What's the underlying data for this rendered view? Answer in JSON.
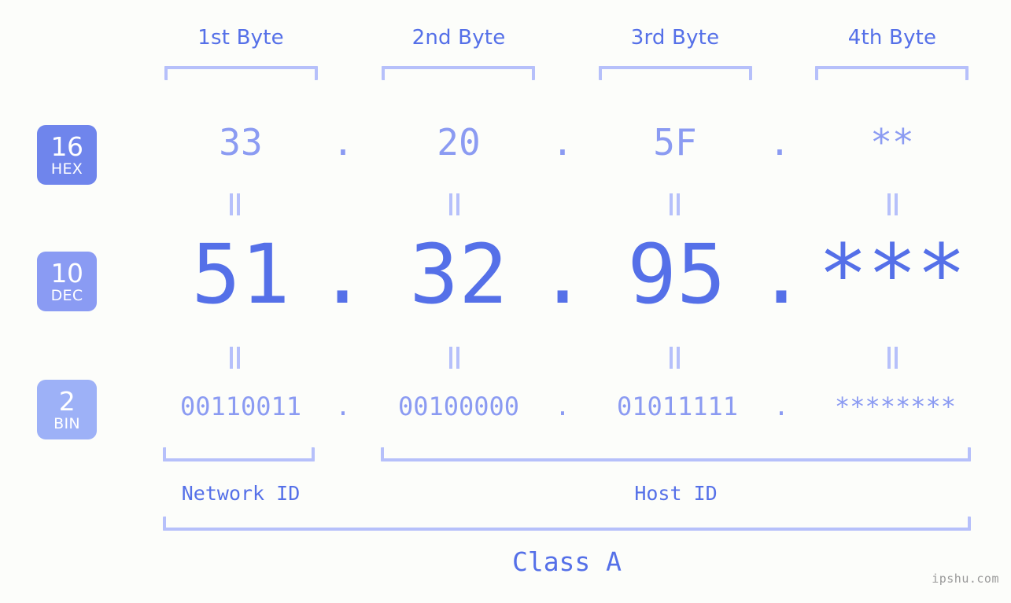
{
  "page": {
    "background": "#fcfdfa",
    "accent_strong": "#5570e8",
    "accent_mid": "#8b9bf2",
    "accent_light": "#b6c0fa",
    "watermark": "ipshu.com"
  },
  "headers": [
    {
      "label": "1st Byte"
    },
    {
      "label": "2nd Byte"
    },
    {
      "label": "3rd Byte"
    },
    {
      "label": "4th Byte"
    }
  ],
  "bases": [
    {
      "num": "16",
      "name": "HEX",
      "color": "#6f85ec"
    },
    {
      "num": "10",
      "name": "DEC",
      "color": "#8a9bf3"
    },
    {
      "num": "2",
      "name": "BIN",
      "color": "#9db1f7"
    }
  ],
  "rows": {
    "hex": {
      "base_num": "16",
      "base_name": "HEX",
      "values": [
        "33",
        "20",
        "5F",
        "**"
      ],
      "separator": "."
    },
    "dec": {
      "base_num": "10",
      "base_name": "DEC",
      "values": [
        "51",
        "32",
        "95",
        "***"
      ],
      "separator": "."
    },
    "bin": {
      "base_num": "2",
      "base_name": "BIN",
      "values": [
        "00110011",
        "00100000",
        "01011111",
        "********"
      ],
      "separator": "."
    }
  },
  "equals_marks": {
    "symbol": "||",
    "count_per_gap": 4
  },
  "footer": {
    "network_id": "Network ID",
    "host_id": "Host ID",
    "class": "Class A"
  }
}
